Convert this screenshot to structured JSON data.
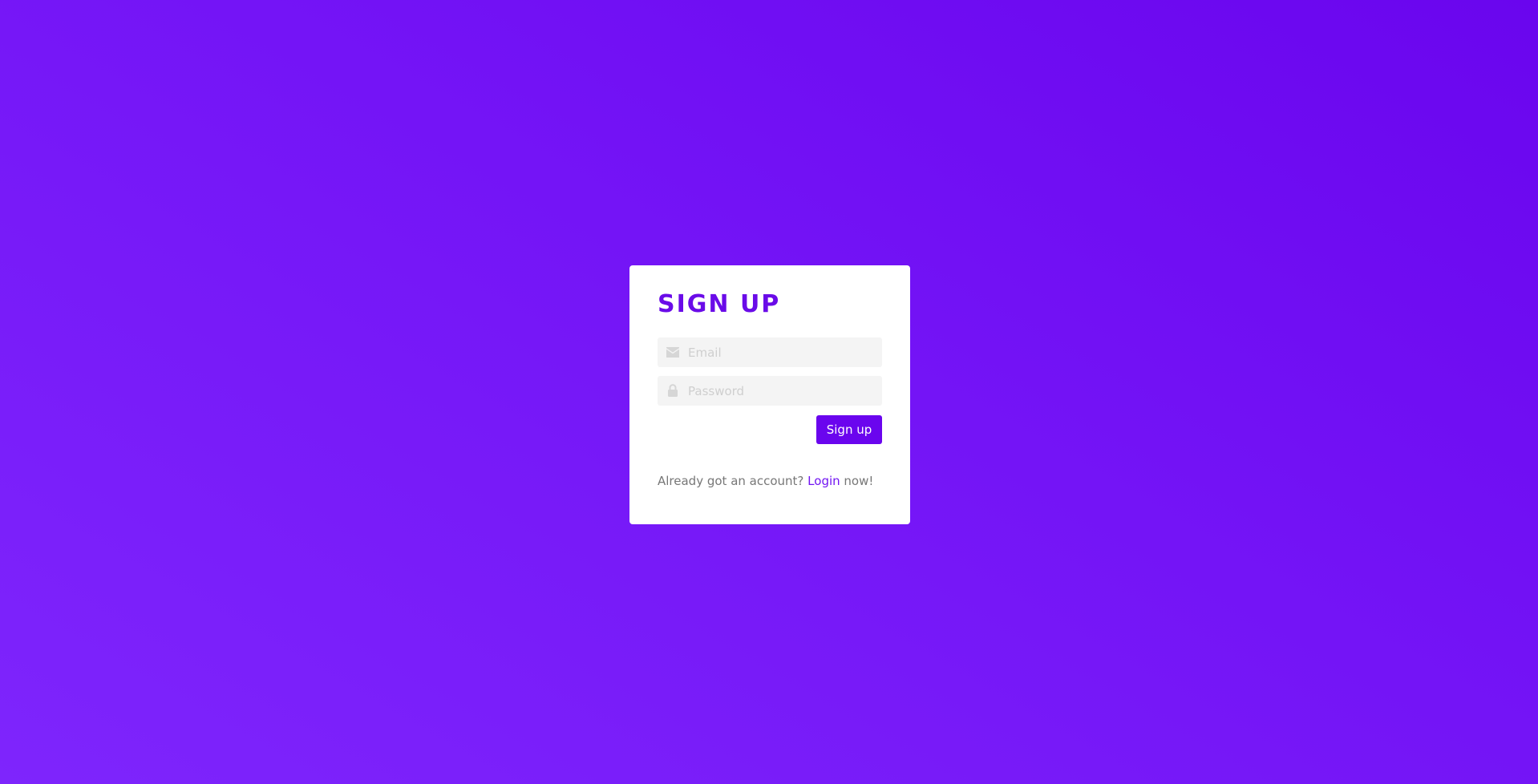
{
  "colors": {
    "accent": "#6a05ee",
    "link": "#7114f2",
    "card": "#ffffff",
    "input_bg": "#f4f4f4",
    "placeholder": "#cfcfcf",
    "muted_text": "#777777"
  },
  "form": {
    "title": "SIGN UP",
    "email": {
      "placeholder": "Email",
      "value": "",
      "icon": "envelope-icon"
    },
    "password": {
      "placeholder": "Password",
      "value": "",
      "icon": "lock-icon"
    },
    "submit_label": "Sign up"
  },
  "footer": {
    "prefix": "Already got an account?",
    "link_label": "Login",
    "suffix": "now!"
  }
}
